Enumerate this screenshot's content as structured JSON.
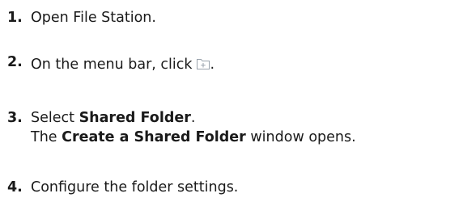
{
  "steps": [
    {
      "number": "1.",
      "text": "Open File Station."
    },
    {
      "number": "2.",
      "text_before": "On the menu bar, click",
      "icon": "create-folder-icon",
      "text_after": "."
    },
    {
      "number": "3.",
      "line1_before": "Select ",
      "line1_bold": "Shared Folder",
      "line1_after": ".",
      "line2_before": "The ",
      "line2_bold": "Create a Shared Folder",
      "line2_after": " window opens."
    },
    {
      "number": "4.",
      "text": "Configure the folder settings."
    }
  ],
  "colors": {
    "text": "#1a1a1a",
    "icon_stroke": "#9aa3ad"
  }
}
